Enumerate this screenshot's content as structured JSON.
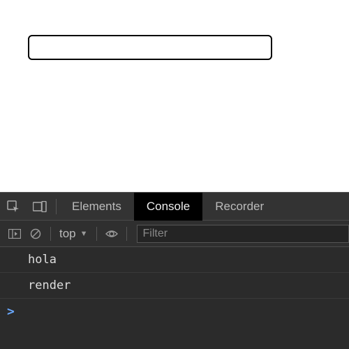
{
  "page": {
    "input_value": ""
  },
  "devtools": {
    "tabs": {
      "elements": "Elements",
      "console": "Console",
      "recorder": "Recorder"
    },
    "active_tab": "console",
    "toolbar": {
      "context": "top",
      "filter_placeholder": "Filter"
    },
    "console": {
      "logs": [
        "hola",
        "render"
      ],
      "prompt": ">"
    }
  }
}
